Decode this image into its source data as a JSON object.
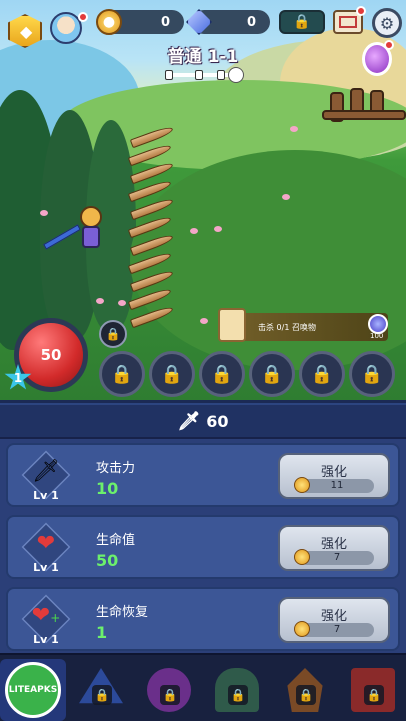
{
  "hud": {
    "gold": "0",
    "gems": "0",
    "stage_title": "普通 1-1",
    "stage_progress": 0.0
  },
  "battle": {
    "hp_orb_value": "50",
    "player_level": "1",
    "quest_text": "击杀 0/1 召唤物",
    "quest_reward": "100"
  },
  "attack_bar": {
    "value": "60"
  },
  "upgrades": [
    {
      "icon": "sword-icon",
      "level": "Lv 1",
      "name": "攻击力",
      "value": "10",
      "button_label": "强化",
      "cost": "11"
    },
    {
      "icon": "heart-icon",
      "level": "Lv 1",
      "name": "生命值",
      "value": "50",
      "button_label": "强化",
      "cost": "7"
    },
    {
      "icon": "heart-plus-icon",
      "level": "Lv 1",
      "name": "生命恢复",
      "value": "1",
      "button_label": "强化",
      "cost": "7"
    }
  ],
  "nav": {
    "brand_label": "LITEAPKS"
  },
  "colors": {
    "hp_red": "#d22a2a",
    "stat_green": "#6cf06c",
    "panel_blue": "#2b3f78",
    "level_star": "#3bc6e8"
  }
}
